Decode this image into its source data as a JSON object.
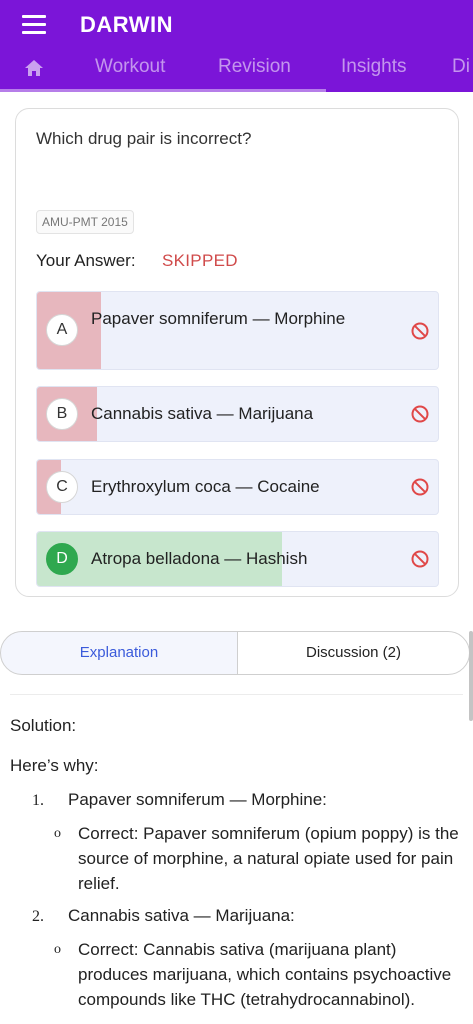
{
  "app": {
    "title": "DARWIN"
  },
  "nav": {
    "tabs": [
      "Workout",
      "Revision",
      "Insights",
      "Di"
    ]
  },
  "question": {
    "text": "Which drug pair is incorrect?",
    "tag": "AMU-PMT 2015",
    "answer_label": "Your Answer:",
    "answer_status": "SKIPPED",
    "options": [
      {
        "letter": "A",
        "text": "Papaver somniferum — Morphine",
        "percent": 16
      },
      {
        "letter": "B",
        "text": "Cannabis sativa — Marijuana",
        "percent": 15
      },
      {
        "letter": "C",
        "text": "Erythroxylum coca — Cocaine",
        "percent": 6
      },
      {
        "letter": "D",
        "text": "Atropa belladona — Hashish",
        "percent": 61,
        "correct": true
      }
    ]
  },
  "detail_tabs": {
    "explanation": "Explanation",
    "discussion": "Discussion (2)"
  },
  "solution": {
    "title": "Solution:",
    "intro": "Here’s why:",
    "items": [
      {
        "num": "1.",
        "title": "Papaver somniferum — Morphine:",
        "bullet": "o",
        "detail": "Correct: Papaver somniferum (opium poppy) is the source of morphine, a natural opiate used for pain relief."
      },
      {
        "num": "2.",
        "title": "Cannabis sativa — Marijuana:",
        "bullet": "o",
        "detail": "Correct: Cannabis sativa (marijuana plant) produces marijuana, which contains psychoactive compounds like THC (tetrahydrocannabinol)."
      }
    ]
  },
  "colors": {
    "primary": "#7b15d8",
    "wrong_fill": "#e7b7be",
    "correct_fill": "#c7e6cd",
    "status_red": "#d04a4a",
    "correct_green": "#2fa84f"
  },
  "icons": {
    "menu": "hamburger-menu-icon",
    "home": "home-icon",
    "option_status": "prohibited-icon"
  }
}
